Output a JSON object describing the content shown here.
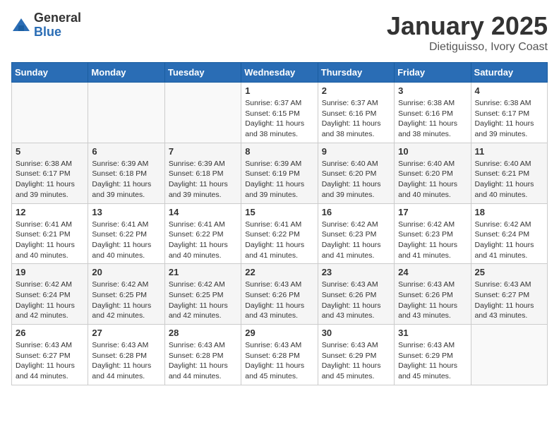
{
  "logo": {
    "general": "General",
    "blue": "Blue"
  },
  "title": "January 2025",
  "subtitle": "Dietiguisso, Ivory Coast",
  "days": [
    "Sunday",
    "Monday",
    "Tuesday",
    "Wednesday",
    "Thursday",
    "Friday",
    "Saturday"
  ],
  "weeks": [
    [
      {
        "date": "",
        "info": ""
      },
      {
        "date": "",
        "info": ""
      },
      {
        "date": "",
        "info": ""
      },
      {
        "date": "1",
        "info": "Sunrise: 6:37 AM\nSunset: 6:15 PM\nDaylight: 11 hours and 38 minutes."
      },
      {
        "date": "2",
        "info": "Sunrise: 6:37 AM\nSunset: 6:16 PM\nDaylight: 11 hours and 38 minutes."
      },
      {
        "date": "3",
        "info": "Sunrise: 6:38 AM\nSunset: 6:16 PM\nDaylight: 11 hours and 38 minutes."
      },
      {
        "date": "4",
        "info": "Sunrise: 6:38 AM\nSunset: 6:17 PM\nDaylight: 11 hours and 39 minutes."
      }
    ],
    [
      {
        "date": "5",
        "info": "Sunrise: 6:38 AM\nSunset: 6:17 PM\nDaylight: 11 hours and 39 minutes."
      },
      {
        "date": "6",
        "info": "Sunrise: 6:39 AM\nSunset: 6:18 PM\nDaylight: 11 hours and 39 minutes."
      },
      {
        "date": "7",
        "info": "Sunrise: 6:39 AM\nSunset: 6:18 PM\nDaylight: 11 hours and 39 minutes."
      },
      {
        "date": "8",
        "info": "Sunrise: 6:39 AM\nSunset: 6:19 PM\nDaylight: 11 hours and 39 minutes."
      },
      {
        "date": "9",
        "info": "Sunrise: 6:40 AM\nSunset: 6:20 PM\nDaylight: 11 hours and 39 minutes."
      },
      {
        "date": "10",
        "info": "Sunrise: 6:40 AM\nSunset: 6:20 PM\nDaylight: 11 hours and 40 minutes."
      },
      {
        "date": "11",
        "info": "Sunrise: 6:40 AM\nSunset: 6:21 PM\nDaylight: 11 hours and 40 minutes."
      }
    ],
    [
      {
        "date": "12",
        "info": "Sunrise: 6:41 AM\nSunset: 6:21 PM\nDaylight: 11 hours and 40 minutes."
      },
      {
        "date": "13",
        "info": "Sunrise: 6:41 AM\nSunset: 6:22 PM\nDaylight: 11 hours and 40 minutes."
      },
      {
        "date": "14",
        "info": "Sunrise: 6:41 AM\nSunset: 6:22 PM\nDaylight: 11 hours and 40 minutes."
      },
      {
        "date": "15",
        "info": "Sunrise: 6:41 AM\nSunset: 6:22 PM\nDaylight: 11 hours and 41 minutes."
      },
      {
        "date": "16",
        "info": "Sunrise: 6:42 AM\nSunset: 6:23 PM\nDaylight: 11 hours and 41 minutes."
      },
      {
        "date": "17",
        "info": "Sunrise: 6:42 AM\nSunset: 6:23 PM\nDaylight: 11 hours and 41 minutes."
      },
      {
        "date": "18",
        "info": "Sunrise: 6:42 AM\nSunset: 6:24 PM\nDaylight: 11 hours and 41 minutes."
      }
    ],
    [
      {
        "date": "19",
        "info": "Sunrise: 6:42 AM\nSunset: 6:24 PM\nDaylight: 11 hours and 42 minutes."
      },
      {
        "date": "20",
        "info": "Sunrise: 6:42 AM\nSunset: 6:25 PM\nDaylight: 11 hours and 42 minutes."
      },
      {
        "date": "21",
        "info": "Sunrise: 6:42 AM\nSunset: 6:25 PM\nDaylight: 11 hours and 42 minutes."
      },
      {
        "date": "22",
        "info": "Sunrise: 6:43 AM\nSunset: 6:26 PM\nDaylight: 11 hours and 43 minutes."
      },
      {
        "date": "23",
        "info": "Sunrise: 6:43 AM\nSunset: 6:26 PM\nDaylight: 11 hours and 43 minutes."
      },
      {
        "date": "24",
        "info": "Sunrise: 6:43 AM\nSunset: 6:26 PM\nDaylight: 11 hours and 43 minutes."
      },
      {
        "date": "25",
        "info": "Sunrise: 6:43 AM\nSunset: 6:27 PM\nDaylight: 11 hours and 43 minutes."
      }
    ],
    [
      {
        "date": "26",
        "info": "Sunrise: 6:43 AM\nSunset: 6:27 PM\nDaylight: 11 hours and 44 minutes."
      },
      {
        "date": "27",
        "info": "Sunrise: 6:43 AM\nSunset: 6:28 PM\nDaylight: 11 hours and 44 minutes."
      },
      {
        "date": "28",
        "info": "Sunrise: 6:43 AM\nSunset: 6:28 PM\nDaylight: 11 hours and 44 minutes."
      },
      {
        "date": "29",
        "info": "Sunrise: 6:43 AM\nSunset: 6:28 PM\nDaylight: 11 hours and 45 minutes."
      },
      {
        "date": "30",
        "info": "Sunrise: 6:43 AM\nSunset: 6:29 PM\nDaylight: 11 hours and 45 minutes."
      },
      {
        "date": "31",
        "info": "Sunrise: 6:43 AM\nSunset: 6:29 PM\nDaylight: 11 hours and 45 minutes."
      },
      {
        "date": "",
        "info": ""
      }
    ]
  ]
}
